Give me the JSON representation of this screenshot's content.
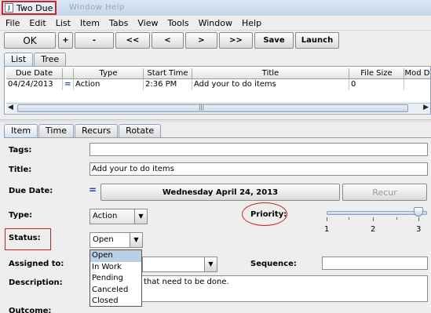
{
  "window": {
    "title": "Two Due",
    "ghost_menu": "Window   Help"
  },
  "menubar": [
    "File",
    "Edit",
    "List",
    "Item",
    "Tabs",
    "View",
    "Tools",
    "Window",
    "Help"
  ],
  "toolbar": {
    "ok": "OK",
    "add": "+",
    "remove": "-",
    "first": "<<",
    "prev": "<",
    "next": ">",
    "last": ">>",
    "save": "Save",
    "launch": "Launch"
  },
  "list_tabs": [
    "List",
    "Tree"
  ],
  "table": {
    "columns": [
      "Due Date",
      "",
      "Type",
      "Start Time",
      "Title",
      "File Size",
      "Mod D"
    ],
    "rows": [
      {
        "due_date": "04/24/2013",
        "marker": "=",
        "type": "Action",
        "start_time": "2:36 PM",
        "title": "Add your to do items",
        "file_size": "0",
        "mod": ""
      }
    ]
  },
  "item_tabs": [
    "Item",
    "Time",
    "Recurs",
    "Rotate"
  ],
  "form": {
    "tags_label": "Tags:",
    "tags_value": "",
    "title_label": "Title:",
    "title_value": "Add your to do items",
    "due_date_label": "Due Date:",
    "due_marker": "=",
    "due_date_value": "Wednesday  April 24, 2013",
    "recur_button": "Recur",
    "type_label": "Type:",
    "type_value": "Action",
    "priority_label": "Priority:",
    "priority_ticks": [
      "1",
      "2",
      "3"
    ],
    "priority_value": 3,
    "status_label": "Status:",
    "status_value": "Open",
    "status_options": [
      "Open",
      "In Work",
      "Pending",
      "Canceled",
      "Closed"
    ],
    "assigned_label": "Assigned to:",
    "sequence_label": "Sequence:",
    "description_label": "Description:",
    "description_value": "that need to be done.",
    "outcome_label": "Outcome:"
  },
  "colors": {
    "highlight": "#d0202a",
    "selection": "#b8cfe5",
    "accent_blue": "#1a3fbf"
  }
}
